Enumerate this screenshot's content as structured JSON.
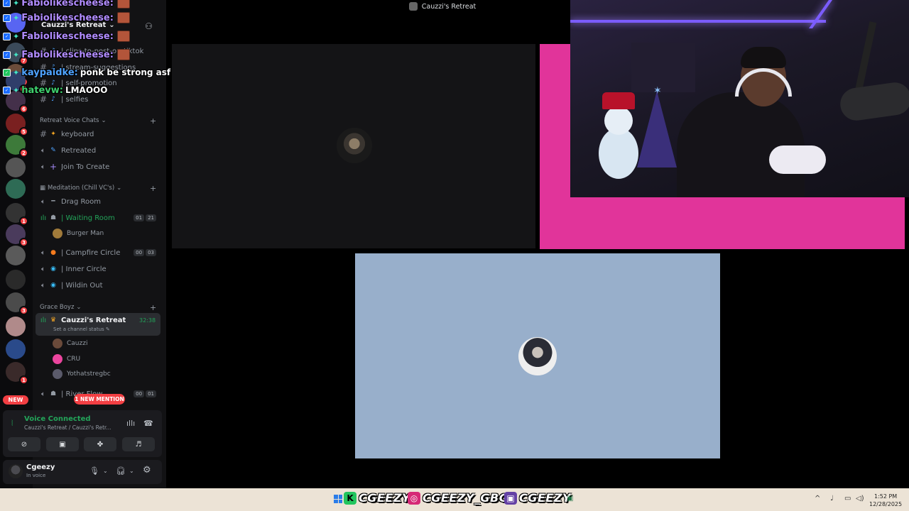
{
  "window": {
    "title": "Cauzzi's Retreat"
  },
  "server": {
    "name": "Cauzzi's Retreat"
  },
  "channels": {
    "text": [
      "| clips-to-post-on-tiktok",
      "| stream-suggestions",
      "| self-promotion",
      "| selfies"
    ],
    "categories": {
      "retreat_voice": "Retreat Voice Chats",
      "meditation": "Meditation (Chill VC's)",
      "grace_boyz": "Grace Boyz"
    },
    "keyboard": "keyboard",
    "retreated": "Retreated",
    "join_to_create": "Join To Create",
    "drag_room": "Drag Room",
    "waiting_room": "| Waiting Room",
    "waiting_room_counts": [
      "01",
      "21"
    ],
    "waiting_room_user": "Burger Man",
    "campfire": "| Campfire Circle",
    "campfire_counts": [
      "00",
      "03"
    ],
    "inner_circle": "| Inner Circle",
    "wildin_out": "| Wildin Out",
    "cauzzis_retreat": "Cauzzi's Retreat",
    "cauzzis_timer": "32:38",
    "set_status": "Set a channel status",
    "retreat_users": [
      "Cauzzi",
      "CRU",
      "Yothatstregbc"
    ],
    "river_flow": "| River Flow",
    "river_counts": [
      "00",
      "01"
    ]
  },
  "pills": {
    "new": "NEW",
    "mention": "1 NEW MENTION"
  },
  "rail": {
    "badges": [
      "7",
      "2",
      "7",
      "6",
      "5",
      "2",
      "1",
      "3",
      "3",
      "1"
    ]
  },
  "voice": {
    "title": "Voice Connected",
    "subtitle": "Cauzzi's Retreat / Cauzzi's Retr..."
  },
  "me": {
    "name": "Cgeezy",
    "status": "In voice"
  },
  "chat": [
    {
      "name": "Fabiolikescheese:",
      "color": "#b18cff",
      "message": ""
    },
    {
      "name": "Fabiolikescheese:",
      "color": "#b18cff",
      "message": ""
    },
    {
      "name": "Fabiolikescheese:",
      "color": "#b18cff",
      "message": ""
    },
    {
      "name": "kaypaidke:",
      "color": "#4fa3ff",
      "message": "ponk be strong asf"
    },
    {
      "name": "hatevw:",
      "color": "#3fd16e",
      "message": "LMAOOO"
    }
  ],
  "taskbar": {
    "kick": "CGEEZY",
    "instagram": "CGEEZY_GBC",
    "twitch": "CGEEZY",
    "time": "1:52 PM",
    "date": "12/28/2025"
  },
  "colors": {
    "tile_pink": "#e1349a",
    "tile_blue": "#98afcb",
    "voice_green": "#23a55a",
    "notif_red": "#f23f43"
  }
}
